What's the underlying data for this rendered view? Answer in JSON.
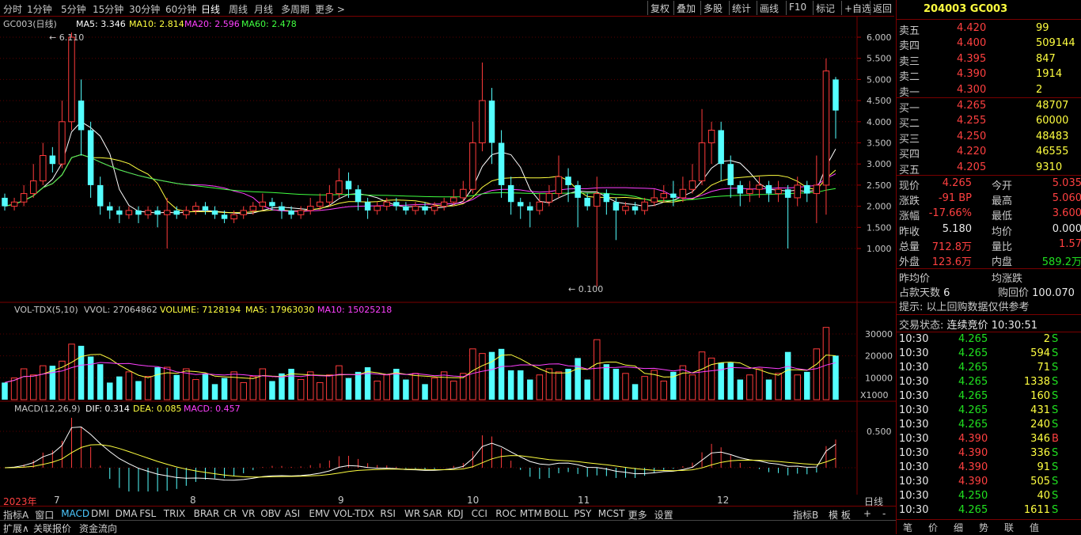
{
  "periods": [
    "分时",
    "1分钟",
    "5分钟",
    "15分钟",
    "30分钟",
    "60分钟",
    "日线",
    "周线",
    "月线",
    "多周期",
    "更多 >"
  ],
  "active_period": "日线",
  "toolbar": [
    "复权",
    "叠加",
    "多股",
    "统计",
    "画线",
    "F10",
    "标记",
    "+自选",
    "返回"
  ],
  "main_legend": {
    "name": "GC003(日线)",
    "ma5": "MA5: 3.346",
    "ma10": "MA10: 2.814",
    "ma20": "MA20: 2.596",
    "ma60": "MA60: 2.478"
  },
  "price_axis": [
    "6.000",
    "5.500",
    "5.000",
    "4.500",
    "4.000",
    "3.500",
    "3.000",
    "2.500",
    "2.000",
    "1.500",
    "1.000"
  ],
  "high_label": "6.110",
  "low_label": "0.100",
  "vol_legend": {
    "name": "VOL-TDX(5,10)",
    "vvol": "VVOL: 27064862",
    "volume": "VOLUME: 7128194",
    "ma5": "MA5: 17963030",
    "ma10": "MA10: 15025218"
  },
  "vol_axis": [
    "30000",
    "20000",
    "10000"
  ],
  "vol_unit": "X1000",
  "macd_legend": {
    "name": "MACD(12,26,9)",
    "dif": "DIF: 0.314",
    "dea": "DEA: 0.085",
    "macd": "MACD: 0.457"
  },
  "macd_axis": "0.500",
  "x_axis": {
    "year": "2023年",
    "months": [
      "7",
      "8",
      "9",
      "10",
      "11",
      "12"
    ],
    "daily_label": "日线"
  },
  "indicator_tabs": [
    "指标A",
    "窗口",
    "MACD",
    "DMI",
    "DMA",
    "FSL",
    "TRIX",
    "BRAR",
    "CR",
    "VR",
    "OBV",
    "ASI",
    "EMV",
    "VOL-TDX",
    "RSI",
    "WR",
    "SAR",
    "KDJ",
    "CCI",
    "ROC",
    "MTM",
    "BOLL",
    "PSY",
    "MCST",
    "更多",
    "设置"
  ],
  "active_indicator": "MACD",
  "right_tabs": [
    "指标B",
    "模 板",
    "+",
    "-"
  ],
  "bottom_tabs": [
    "扩展∧",
    "关联报价",
    "资金流向"
  ],
  "quote": {
    "title": "204003 GC003",
    "asks": [
      {
        "label": "卖五",
        "price": "4.420",
        "vol": "99"
      },
      {
        "label": "卖四",
        "price": "4.400",
        "vol": "509144"
      },
      {
        "label": "卖三",
        "price": "4.395",
        "vol": "847"
      },
      {
        "label": "卖二",
        "price": "4.390",
        "vol": "1914"
      },
      {
        "label": "卖一",
        "price": "4.300",
        "vol": "2"
      }
    ],
    "bids": [
      {
        "label": "买一",
        "price": "4.265",
        "vol": "48707"
      },
      {
        "label": "买二",
        "price": "4.255",
        "vol": "60000"
      },
      {
        "label": "买三",
        "price": "4.250",
        "vol": "48483"
      },
      {
        "label": "买四",
        "price": "4.220",
        "vol": "46555"
      },
      {
        "label": "买五",
        "price": "4.205",
        "vol": "9310"
      }
    ],
    "stats": [
      {
        "l1": "现价",
        "v1": "4.265",
        "l2": "今开",
        "v2": "5.035"
      },
      {
        "l1": "涨跌",
        "v1": "-91 BP",
        "l2": "最高",
        "v2": "5.060"
      },
      {
        "l1": "涨幅",
        "v1": "-17.66%",
        "l2": "最低",
        "v2": "3.600"
      },
      {
        "l1": "昨收",
        "v1": "5.180",
        "l2": "均价",
        "v2": "0.000"
      },
      {
        "l1": "总量",
        "v1": "712.8万",
        "l2": "量比",
        "v2": "1.57"
      },
      {
        "l1": "外盘",
        "v1": "123.6万",
        "l2": "内盘",
        "v2": "589.2万"
      }
    ],
    "extra": {
      "avg_prev": "昨均价",
      "avg_change": "均涨跌",
      "days_label": "占款天数",
      "days": "6",
      "buyback_label": "购回价",
      "buyback": "100.070",
      "hint": "提示: 以上回购数据仅供参考",
      "status_label": "交易状态:",
      "status": "连续竞价",
      "status_time": "10:30:51"
    },
    "ticks": [
      {
        "t": "10:30",
        "p": "4.265",
        "v": "2",
        "s": "S"
      },
      {
        "t": "10:30",
        "p": "4.265",
        "v": "594",
        "s": "S"
      },
      {
        "t": "10:30",
        "p": "4.265",
        "v": "71",
        "s": "S"
      },
      {
        "t": "10:30",
        "p": "4.265",
        "v": "1338",
        "s": "S"
      },
      {
        "t": "10:30",
        "p": "4.265",
        "v": "160",
        "s": "S"
      },
      {
        "t": "10:30",
        "p": "4.265",
        "v": "431",
        "s": "S"
      },
      {
        "t": "10:30",
        "p": "4.265",
        "v": "240",
        "s": "S"
      },
      {
        "t": "10:30",
        "p": "4.390",
        "v": "346",
        "s": "B"
      },
      {
        "t": "10:30",
        "p": "4.390",
        "v": "336",
        "s": "S"
      },
      {
        "t": "10:30",
        "p": "4.390",
        "v": "91",
        "s": "S"
      },
      {
        "t": "10:30",
        "p": "4.390",
        "v": "505",
        "s": "S"
      },
      {
        "t": "10:30",
        "p": "4.250",
        "v": "40",
        "s": "S"
      },
      {
        "t": "10:30",
        "p": "4.265",
        "v": "1611",
        "s": "S"
      }
    ],
    "footer_tabs": [
      "笔",
      "价",
      "细",
      "势",
      "联",
      "值"
    ]
  },
  "chart_data": {
    "type": "candlestick",
    "y_range": [
      0.1,
      6.11
    ],
    "candles": [
      [
        2.2,
        2.0,
        2.3,
        1.9
      ],
      [
        2.0,
        2.1,
        2.2,
        1.9
      ],
      [
        2.1,
        2.3,
        2.5,
        2.0
      ],
      [
        2.3,
        2.6,
        3.0,
        2.2
      ],
      [
        2.6,
        3.2,
        3.5,
        2.5
      ],
      [
        3.2,
        3.0,
        3.4,
        2.8
      ],
      [
        3.0,
        4.0,
        4.5,
        2.9
      ],
      [
        4.0,
        6.0,
        6.11,
        3.8
      ],
      [
        4.5,
        3.8,
        5.0,
        3.2
      ],
      [
        3.8,
        2.5,
        4.0,
        2.2
      ],
      [
        2.5,
        2.0,
        2.7,
        1.8
      ],
      [
        2.0,
        1.9,
        2.1,
        1.7
      ],
      [
        1.9,
        1.8,
        2.0,
        1.6
      ],
      [
        1.8,
        1.9,
        2.0,
        1.7
      ],
      [
        1.9,
        1.8,
        2.0,
        1.6
      ],
      [
        1.8,
        1.9,
        2.0,
        1.7
      ],
      [
        1.9,
        1.8,
        2.0,
        1.5
      ],
      [
        1.8,
        1.9,
        2.2,
        1.0
      ],
      [
        1.9,
        1.8,
        2.0,
        1.7
      ],
      [
        1.8,
        1.9,
        2.0,
        1.7
      ],
      [
        1.9,
        2.0,
        2.1,
        1.8
      ],
      [
        2.0,
        1.9,
        2.1,
        1.8
      ],
      [
        1.9,
        1.8,
        2.0,
        1.7
      ],
      [
        1.8,
        1.7,
        1.9,
        1.6
      ],
      [
        1.7,
        1.8,
        1.9,
        1.6
      ],
      [
        1.8,
        1.9,
        2.0,
        1.7
      ],
      [
        1.9,
        2.0,
        2.1,
        1.8
      ],
      [
        2.0,
        2.1,
        2.3,
        1.9
      ],
      [
        2.1,
        2.0,
        2.2,
        1.9
      ],
      [
        2.0,
        1.9,
        2.1,
        1.7
      ],
      [
        1.9,
        1.8,
        2.0,
        1.7
      ],
      [
        1.8,
        1.9,
        2.0,
        1.7
      ],
      [
        1.9,
        2.0,
        2.2,
        1.8
      ],
      [
        2.0,
        2.1,
        2.3,
        1.9
      ],
      [
        2.1,
        2.3,
        2.5,
        2.0
      ],
      [
        2.3,
        2.6,
        2.9,
        2.2
      ],
      [
        2.6,
        2.4,
        2.8,
        2.2
      ],
      [
        2.4,
        2.1,
        2.5,
        1.9
      ],
      [
        2.1,
        1.9,
        2.2,
        1.7
      ],
      [
        1.9,
        2.0,
        2.1,
        1.8
      ],
      [
        2.0,
        2.1,
        2.2,
        1.9
      ],
      [
        2.1,
        2.0,
        2.2,
        1.9
      ],
      [
        2.0,
        1.9,
        2.1,
        1.8
      ],
      [
        1.9,
        2.0,
        2.1,
        1.8
      ],
      [
        2.0,
        1.9,
        2.1,
        1.8
      ],
      [
        1.9,
        2.0,
        2.1,
        1.8
      ],
      [
        2.0,
        2.1,
        2.2,
        1.9
      ],
      [
        2.1,
        2.2,
        2.4,
        2.0
      ],
      [
        2.2,
        2.4,
        2.6,
        2.1
      ],
      [
        2.4,
        3.5,
        4.0,
        2.3
      ],
      [
        3.5,
        4.5,
        5.4,
        3.3
      ],
      [
        4.5,
        3.5,
        4.8,
        3.0
      ],
      [
        3.5,
        2.5,
        3.8,
        2.2
      ],
      [
        2.5,
        2.1,
        2.7,
        1.8
      ],
      [
        2.1,
        2.0,
        2.2,
        1.7
      ],
      [
        2.0,
        1.9,
        2.1,
        1.5
      ],
      [
        1.9,
        2.1,
        2.3,
        1.8
      ],
      [
        2.1,
        2.3,
        2.5,
        2.0
      ],
      [
        2.3,
        2.7,
        3.2,
        2.2
      ],
      [
        2.7,
        2.5,
        2.9,
        2.1
      ],
      [
        2.5,
        2.2,
        2.6,
        1.5
      ],
      [
        2.2,
        2.0,
        2.3,
        1.9
      ],
      [
        2.0,
        2.3,
        2.7,
        0.1
      ],
      [
        2.3,
        2.1,
        2.4,
        1.8
      ],
      [
        2.1,
        1.9,
        2.2,
        1.2
      ],
      [
        1.9,
        2.0,
        2.1,
        1.8
      ],
      [
        2.0,
        1.9,
        2.1,
        1.8
      ],
      [
        1.9,
        2.1,
        2.2,
        1.8
      ],
      [
        2.1,
        2.2,
        2.4,
        2.0
      ],
      [
        2.2,
        2.3,
        2.5,
        2.1
      ],
      [
        2.3,
        2.2,
        2.6,
        2.0
      ],
      [
        2.2,
        2.4,
        2.7,
        2.1
      ],
      [
        2.4,
        2.6,
        3.0,
        2.3
      ],
      [
        2.6,
        3.5,
        4.3,
        2.5
      ],
      [
        3.5,
        3.8,
        4.0,
        3.0
      ],
      [
        3.8,
        3.0,
        4.0,
        2.6
      ],
      [
        3.0,
        2.5,
        3.2,
        2.2
      ],
      [
        2.5,
        2.3,
        2.6,
        2.0
      ],
      [
        2.3,
        2.4,
        2.6,
        2.1
      ],
      [
        2.4,
        2.5,
        2.7,
        2.2
      ],
      [
        2.5,
        2.3,
        2.6,
        2.1
      ],
      [
        2.3,
        2.4,
        2.6,
        2.1
      ],
      [
        2.4,
        2.2,
        2.5,
        1.0
      ],
      [
        2.2,
        2.5,
        2.7,
        2.0
      ],
      [
        2.5,
        2.3,
        2.6,
        2.1
      ],
      [
        2.3,
        2.5,
        3.2,
        1.6
      ],
      [
        2.5,
        5.2,
        5.5,
        1.8
      ],
      [
        5.0,
        4.265,
        5.06,
        3.6
      ]
    ]
  }
}
